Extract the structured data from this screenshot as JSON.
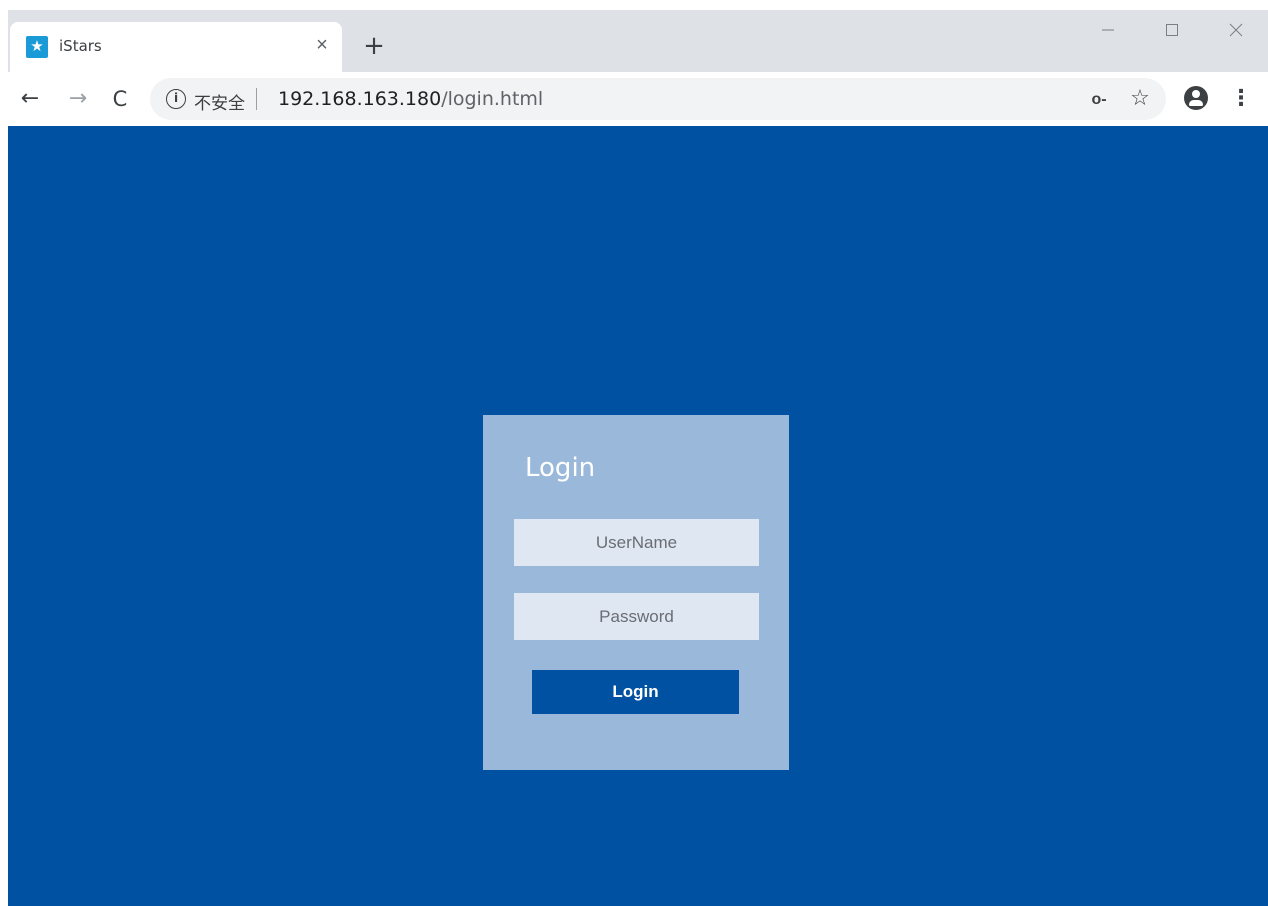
{
  "browser": {
    "tab": {
      "title": "iStars",
      "favicon_icon": "star-icon",
      "close_glyph": "×"
    },
    "new_tab_glyph": "+",
    "window_controls": {
      "minimize_glyph": "—",
      "maximize_glyph": "☐",
      "close_glyph": "✕"
    },
    "toolbar": {
      "back_glyph": "←",
      "forward_glyph": "→",
      "reload_glyph": "C",
      "info_glyph": "i",
      "security_label": "不安全",
      "url_host": "192.168.163.180",
      "url_path": "/login.html",
      "key_glyph": "o-",
      "bookmark_glyph": "☆",
      "menu_glyph": "⋮"
    }
  },
  "login": {
    "heading": "Login",
    "username_placeholder": "UserName",
    "password_placeholder": "Password",
    "submit_label": "Login"
  },
  "colors": {
    "page_background": "#0051a1",
    "card_background": "#9ab9da",
    "field_background": "#dfe7f3",
    "button_background": "#0051a1"
  }
}
